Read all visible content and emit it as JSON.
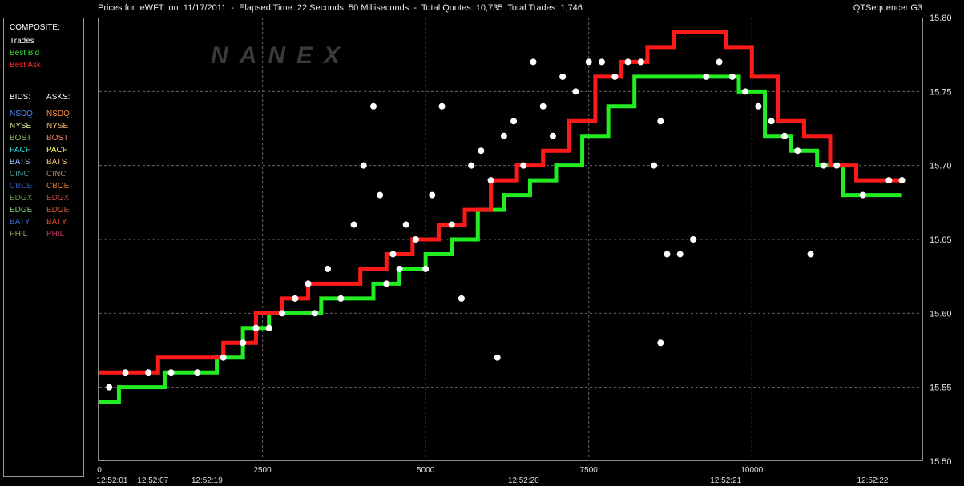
{
  "header": {
    "title": "Prices for  eWFT  on  11/17/2011  -  Elapsed Time: 22 Seconds, 50 Milliseconds  -  Total Quotes: 10,735  Total Trades: 1,746",
    "app_name": "QTSequencer G3"
  },
  "watermark": "NANEX",
  "legend": {
    "composite_title": "COMPOSITE:",
    "composite": [
      {
        "label": "Trades",
        "color": "#ffffff"
      },
      {
        "label": "Best Bid",
        "color": "#33dd33"
      },
      {
        "label": "Best Ask",
        "color": "#ff2a2a"
      }
    ],
    "bids_title": "BIDS:",
    "asks_title": "ASKS:",
    "bids": [
      {
        "label": "NSDQ",
        "color": "#4a8cff"
      },
      {
        "label": "NYSE",
        "color": "#e6e6a0"
      },
      {
        "label": "BOST",
        "color": "#8fbf6a"
      },
      {
        "label": "PACF",
        "color": "#33e6e6"
      },
      {
        "label": "BATS",
        "color": "#9ac8ff"
      },
      {
        "label": "CINC",
        "color": "#4a9a9a"
      },
      {
        "label": "CBOE",
        "color": "#2a5ab0"
      },
      {
        "label": "EDGX",
        "color": "#6a9a4a"
      },
      {
        "label": "EDGE",
        "color": "#7acc7a"
      },
      {
        "label": "BATY",
        "color": "#3a6ad0"
      },
      {
        "label": "PHIL",
        "color": "#8aaa4a"
      }
    ],
    "asks": [
      {
        "label": "NSDQ",
        "color": "#ff8c3a"
      },
      {
        "label": "NYSE",
        "color": "#ffb86a"
      },
      {
        "label": "BOST",
        "color": "#e8826a"
      },
      {
        "label": "PACF",
        "color": "#ffff6a"
      },
      {
        "label": "BATS",
        "color": "#ffc87a"
      },
      {
        "label": "CINC",
        "color": "#aa8a6a"
      },
      {
        "label": "CBOE",
        "color": "#e07a2a"
      },
      {
        "label": "EDGX",
        "color": "#c04a4a"
      },
      {
        "label": "EDGE",
        "color": "#d05a3a"
      },
      {
        "label": "BATY",
        "color": "#e04a2a"
      },
      {
        "label": "PHIL",
        "color": "#c03a6a"
      }
    ]
  },
  "chart_data": {
    "type": "scatter",
    "title": "",
    "xlabel": "",
    "ylabel": "",
    "xlim": [
      0,
      12600
    ],
    "ylim": [
      15.5,
      15.8
    ],
    "y_ticks": [
      "15.50",
      "15.55",
      "15.60",
      "15.65",
      "15.70",
      "15.75",
      "15.80"
    ],
    "x_ticks": [
      {
        "x": 0,
        "label": "0"
      },
      {
        "x": 2500,
        "label": "2500"
      },
      {
        "x": 5000,
        "label": "5000"
      },
      {
        "x": 7500,
        "label": "7500"
      },
      {
        "x": 10000,
        "label": "10000"
      }
    ],
    "time_ticks": [
      {
        "x": 0,
        "label": "12:52:01"
      },
      {
        "x": 820,
        "label": "12:52:07"
      },
      {
        "x": 1650,
        "label": "12:52:19"
      },
      {
        "x": 6500,
        "label": "12:52:20"
      },
      {
        "x": 9600,
        "label": "12:52:21"
      },
      {
        "x": 11850,
        "label": "12:52:22"
      }
    ],
    "grid": true,
    "series": [
      {
        "name": "Best Bid",
        "color": "#22ee22",
        "points": [
          [
            0,
            15.54
          ],
          [
            300,
            15.55
          ],
          [
            700,
            15.55
          ],
          [
            1000,
            15.56
          ],
          [
            1400,
            15.56
          ],
          [
            1800,
            15.57
          ],
          [
            2200,
            15.59
          ],
          [
            2600,
            15.6
          ],
          [
            3000,
            15.6
          ],
          [
            3400,
            15.61
          ],
          [
            3800,
            15.61
          ],
          [
            4200,
            15.62
          ],
          [
            4600,
            15.63
          ],
          [
            5000,
            15.64
          ],
          [
            5400,
            15.65
          ],
          [
            5800,
            15.67
          ],
          [
            6200,
            15.68
          ],
          [
            6600,
            15.69
          ],
          [
            7000,
            15.7
          ],
          [
            7400,
            15.72
          ],
          [
            7800,
            15.74
          ],
          [
            8200,
            15.76
          ],
          [
            8600,
            15.76
          ],
          [
            9000,
            15.76
          ],
          [
            9400,
            15.76
          ],
          [
            9800,
            15.75
          ],
          [
            10200,
            15.72
          ],
          [
            10600,
            15.71
          ],
          [
            11000,
            15.7
          ],
          [
            11400,
            15.68
          ],
          [
            11800,
            15.68
          ],
          [
            12300,
            15.68
          ]
        ]
      },
      {
        "name": "Best Ask",
        "color": "#ff1a1a",
        "points": [
          [
            0,
            15.56
          ],
          [
            400,
            15.56
          ],
          [
            900,
            15.57
          ],
          [
            1400,
            15.57
          ],
          [
            1900,
            15.58
          ],
          [
            2400,
            15.6
          ],
          [
            2800,
            15.61
          ],
          [
            3200,
            15.62
          ],
          [
            3600,
            15.62
          ],
          [
            4000,
            15.63
          ],
          [
            4400,
            15.64
          ],
          [
            4800,
            15.65
          ],
          [
            5200,
            15.66
          ],
          [
            5600,
            15.67
          ],
          [
            6000,
            15.69
          ],
          [
            6400,
            15.7
          ],
          [
            6800,
            15.71
          ],
          [
            7200,
            15.73
          ],
          [
            7600,
            15.76
          ],
          [
            8000,
            15.77
          ],
          [
            8400,
            15.78
          ],
          [
            8800,
            15.79
          ],
          [
            9200,
            15.79
          ],
          [
            9600,
            15.78
          ],
          [
            10000,
            15.76
          ],
          [
            10400,
            15.73
          ],
          [
            10800,
            15.72
          ],
          [
            11200,
            15.7
          ],
          [
            11600,
            15.69
          ],
          [
            12000,
            15.69
          ],
          [
            12300,
            15.69
          ]
        ]
      },
      {
        "name": "Trades",
        "color": "#ffffff",
        "points": [
          [
            150,
            15.55
          ],
          [
            400,
            15.56
          ],
          [
            750,
            15.56
          ],
          [
            1100,
            15.56
          ],
          [
            1500,
            15.56
          ],
          [
            1900,
            15.57
          ],
          [
            2200,
            15.58
          ],
          [
            2400,
            15.59
          ],
          [
            2600,
            15.59
          ],
          [
            2800,
            15.6
          ],
          [
            3000,
            15.61
          ],
          [
            3200,
            15.62
          ],
          [
            3300,
            15.6
          ],
          [
            3500,
            15.63
          ],
          [
            3700,
            15.61
          ],
          [
            3900,
            15.66
          ],
          [
            4050,
            15.7
          ],
          [
            4200,
            15.74
          ],
          [
            4300,
            15.68
          ],
          [
            4400,
            15.62
          ],
          [
            4500,
            15.64
          ],
          [
            4600,
            15.63
          ],
          [
            4700,
            15.66
          ],
          [
            4850,
            15.65
          ],
          [
            5000,
            15.63
          ],
          [
            5100,
            15.68
          ],
          [
            5250,
            15.74
          ],
          [
            5400,
            15.66
          ],
          [
            5550,
            15.61
          ],
          [
            5700,
            15.7
          ],
          [
            5850,
            15.71
          ],
          [
            6000,
            15.69
          ],
          [
            6100,
            15.57
          ],
          [
            6200,
            15.72
          ],
          [
            6350,
            15.73
          ],
          [
            6500,
            15.7
          ],
          [
            6650,
            15.77
          ],
          [
            6800,
            15.74
          ],
          [
            6950,
            15.72
          ],
          [
            7100,
            15.76
          ],
          [
            7300,
            15.75
          ],
          [
            7500,
            15.77
          ],
          [
            7700,
            15.77
          ],
          [
            7900,
            15.76
          ],
          [
            8100,
            15.77
          ],
          [
            8300,
            15.77
          ],
          [
            8500,
            15.7
          ],
          [
            8600,
            15.73
          ],
          [
            8700,
            15.64
          ],
          [
            8900,
            15.64
          ],
          [
            9100,
            15.65
          ],
          [
            8600,
            15.58
          ],
          [
            9300,
            15.76
          ],
          [
            9500,
            15.77
          ],
          [
            9700,
            15.76
          ],
          [
            9900,
            15.75
          ],
          [
            10100,
            15.74
          ],
          [
            10300,
            15.73
          ],
          [
            10500,
            15.72
          ],
          [
            10700,
            15.71
          ],
          [
            10900,
            15.64
          ],
          [
            11100,
            15.7
          ],
          [
            11300,
            15.7
          ],
          [
            11700,
            15.68
          ],
          [
            12100,
            15.69
          ],
          [
            12300,
            15.69
          ]
        ]
      }
    ]
  }
}
